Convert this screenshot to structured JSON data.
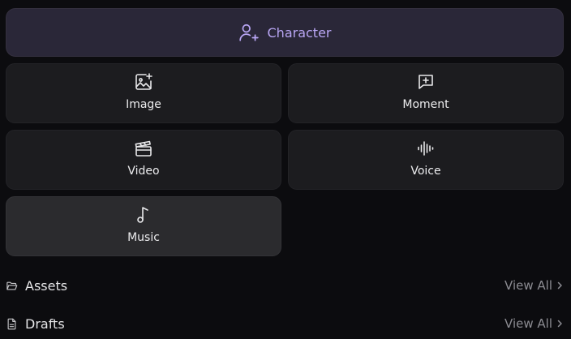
{
  "create": {
    "character_label": "Character",
    "tiles": {
      "image": "Image",
      "moment": "Moment",
      "video": "Video",
      "voice": "Voice",
      "music": "Music"
    }
  },
  "sections": {
    "assets": {
      "title": "Assets",
      "view_all": "View All"
    },
    "drafts": {
      "title": "Drafts",
      "view_all": "View All"
    }
  },
  "icons": {
    "character": "user-plus-icon",
    "image": "image-plus-icon",
    "moment": "message-plus-icon",
    "video": "clapperboard-icon",
    "voice": "audio-waveform-icon",
    "music": "music-note-icon",
    "assets": "folder-open-icon",
    "drafts": "file-text-icon",
    "chevron": "chevron-right-icon"
  },
  "colors": {
    "background": "#0c0c0f",
    "accent": "#b9a6f4",
    "tile": "#1c1c1f",
    "tile_active": "#2b2b2e",
    "character_button": "#2a2738",
    "muted": "#8c8c92"
  }
}
